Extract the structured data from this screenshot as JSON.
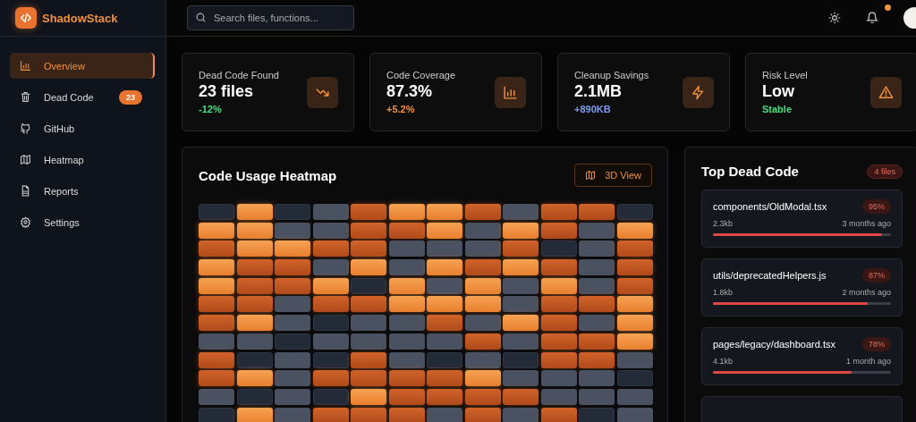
{
  "app": {
    "name": "ShadowStack"
  },
  "nav": [
    {
      "label": "Overview",
      "selected": true
    },
    {
      "label": "Dead Code",
      "selected": false,
      "badge": "23"
    },
    {
      "label": "GitHub",
      "selected": false
    },
    {
      "label": "Heatmap",
      "selected": false
    },
    {
      "label": "Reports",
      "selected": false
    },
    {
      "label": "Settings",
      "selected": false
    }
  ],
  "search": {
    "placeholder": "Search files, functions..."
  },
  "notifications": {
    "unread": true
  },
  "stats": [
    {
      "label": "Dead Code Found",
      "value": "23 files",
      "change": "-12%",
      "color": "#4ade80"
    },
    {
      "label": "Code Coverage",
      "value": "87.3%",
      "change": "+5.2%",
      "color": "#f0913e"
    },
    {
      "label": "Cleanup Savings",
      "value": "2.1MB",
      "change": "+890KB",
      "color": "#7c9cf0"
    },
    {
      "label": "Risk Level",
      "value": "Low",
      "change": "Stable",
      "color": "#4ade80"
    }
  ],
  "heatmap": {
    "title": "Code Usage Heatmap",
    "button": "3D View",
    "rows": [
      [
        {
          "kind": "none"
        },
        {
          "kind": "hot"
        },
        {
          "kind": "none"
        },
        {
          "kind": "low"
        },
        {
          "kind": "warm"
        },
        {
          "kind": "hot"
        },
        {
          "kind": "hot"
        },
        {
          "kind": "warm"
        },
        {
          "kind": "low"
        },
        {
          "kind": "warm"
        },
        {
          "kind": "warm"
        },
        {
          "kind": "none"
        }
      ],
      [
        {
          "kind": "hot"
        },
        {
          "kind": "hot"
        },
        {
          "kind": "low"
        },
        {
          "kind": "low"
        },
        {
          "kind": "warm"
        },
        {
          "kind": "warm"
        },
        {
          "kind": "hot"
        },
        {
          "kind": "low"
        },
        {
          "kind": "hot"
        },
        {
          "kind": "warm"
        },
        {
          "kind": "low"
        },
        {
          "kind": "hot"
        }
      ],
      [
        {
          "kind": "warm"
        },
        {
          "kind": "hot"
        },
        {
          "kind": "hot"
        },
        {
          "kind": "warm"
        },
        {
          "kind": "warm"
        },
        {
          "kind": "low"
        },
        {
          "kind": "low"
        },
        {
          "kind": "low"
        },
        {
          "kind": "warm"
        },
        {
          "kind": "none"
        },
        {
          "kind": "low"
        },
        {
          "kind": "warm"
        }
      ],
      [
        {
          "kind": "hot"
        },
        {
          "kind": "warm"
        },
        {
          "kind": "warm"
        },
        {
          "kind": "low"
        },
        {
          "kind": "hot"
        },
        {
          "kind": "low"
        },
        {
          "kind": "hot"
        },
        {
          "kind": "warm"
        },
        {
          "kind": "hot"
        },
        {
          "kind": "warm"
        },
        {
          "kind": "low"
        },
        {
          "kind": "warm"
        }
      ],
      [
        {
          "kind": "hot"
        },
        {
          "kind": "warm"
        },
        {
          "kind": "warm"
        },
        {
          "kind": "hot"
        },
        {
          "kind": "none"
        },
        {
          "kind": "hot"
        },
        {
          "kind": "low"
        },
        {
          "kind": "hot"
        },
        {
          "kind": "low"
        },
        {
          "kind": "hot"
        },
        {
          "kind": "low"
        },
        {
          "kind": "warm"
        }
      ],
      [
        {
          "kind": "warm"
        },
        {
          "kind": "warm"
        },
        {
          "kind": "low"
        },
        {
          "kind": "warm"
        },
        {
          "kind": "warm"
        },
        {
          "kind": "hot"
        },
        {
          "kind": "hot"
        },
        {
          "kind": "hot"
        },
        {
          "kind": "low"
        },
        {
          "kind": "warm"
        },
        {
          "kind": "warm"
        },
        {
          "kind": "hot"
        }
      ],
      [
        {
          "kind": "warm"
        },
        {
          "kind": "hot"
        },
        {
          "kind": "low"
        },
        {
          "kind": "none"
        },
        {
          "kind": "low"
        },
        {
          "kind": "low"
        },
        {
          "kind": "warm"
        },
        {
          "kind": "low"
        },
        {
          "kind": "hot"
        },
        {
          "kind": "warm"
        },
        {
          "kind": "low"
        },
        {
          "kind": "hot"
        }
      ],
      [
        {
          "kind": "low"
        },
        {
          "kind": "low"
        },
        {
          "kind": "none"
        },
        {
          "kind": "low"
        },
        {
          "kind": "low"
        },
        {
          "kind": "low"
        },
        {
          "kind": "low"
        },
        {
          "kind": "warm"
        },
        {
          "kind": "low"
        },
        {
          "kind": "warm"
        },
        {
          "kind": "warm"
        },
        {
          "kind": "hot"
        }
      ],
      [
        {
          "kind": "warm"
        },
        {
          "kind": "none"
        },
        {
          "kind": "low"
        },
        {
          "kind": "none"
        },
        {
          "kind": "warm"
        },
        {
          "kind": "low"
        },
        {
          "kind": "none"
        },
        {
          "kind": "low"
        },
        {
          "kind": "none"
        },
        {
          "kind": "warm"
        },
        {
          "kind": "warm"
        },
        {
          "kind": "low"
        }
      ],
      [
        {
          "kind": "warm"
        },
        {
          "kind": "hot"
        },
        {
          "kind": "low"
        },
        {
          "kind": "warm"
        },
        {
          "kind": "warm"
        },
        {
          "kind": "warm"
        },
        {
          "kind": "warm"
        },
        {
          "kind": "hot"
        },
        {
          "kind": "low"
        },
        {
          "kind": "low"
        },
        {
          "kind": "low"
        },
        {
          "kind": "none"
        }
      ],
      [
        {
          "kind": "low"
        },
        {
          "kind": "none"
        },
        {
          "kind": "low"
        },
        {
          "kind": "none"
        },
        {
          "kind": "hot"
        },
        {
          "kind": "warm"
        },
        {
          "kind": "warm"
        },
        {
          "kind": "warm"
        },
        {
          "kind": "warm"
        },
        {
          "kind": "low"
        },
        {
          "kind": "low"
        },
        {
          "kind": "low"
        }
      ],
      [
        {
          "kind": "none"
        },
        {
          "kind": "hot"
        },
        {
          "kind": "low"
        },
        {
          "kind": "warm"
        },
        {
          "kind": "warm"
        },
        {
          "kind": "warm"
        },
        {
          "kind": "low"
        },
        {
          "kind": "warm"
        },
        {
          "kind": "low"
        },
        {
          "kind": "warm"
        },
        {
          "kind": "none"
        },
        {
          "kind": "low"
        }
      ]
    ]
  },
  "top_dead_code": {
    "title": "Top Dead Code",
    "count": "4 files",
    "files": [
      {
        "path": "components/OldModal.tsx",
        "percent": "95%",
        "size": "2.3kb",
        "age": "3 months ago",
        "level": 0.95
      },
      {
        "path": "utils/deprecatedHelpers.js",
        "percent": "87%",
        "size": "1.8kb",
        "age": "2 months ago",
        "level": 0.87
      },
      {
        "path": "pages/legacy/dashboard.tsx",
        "percent": "78%",
        "size": "4.1kb",
        "age": "1 month ago",
        "level": 0.78
      }
    ]
  }
}
